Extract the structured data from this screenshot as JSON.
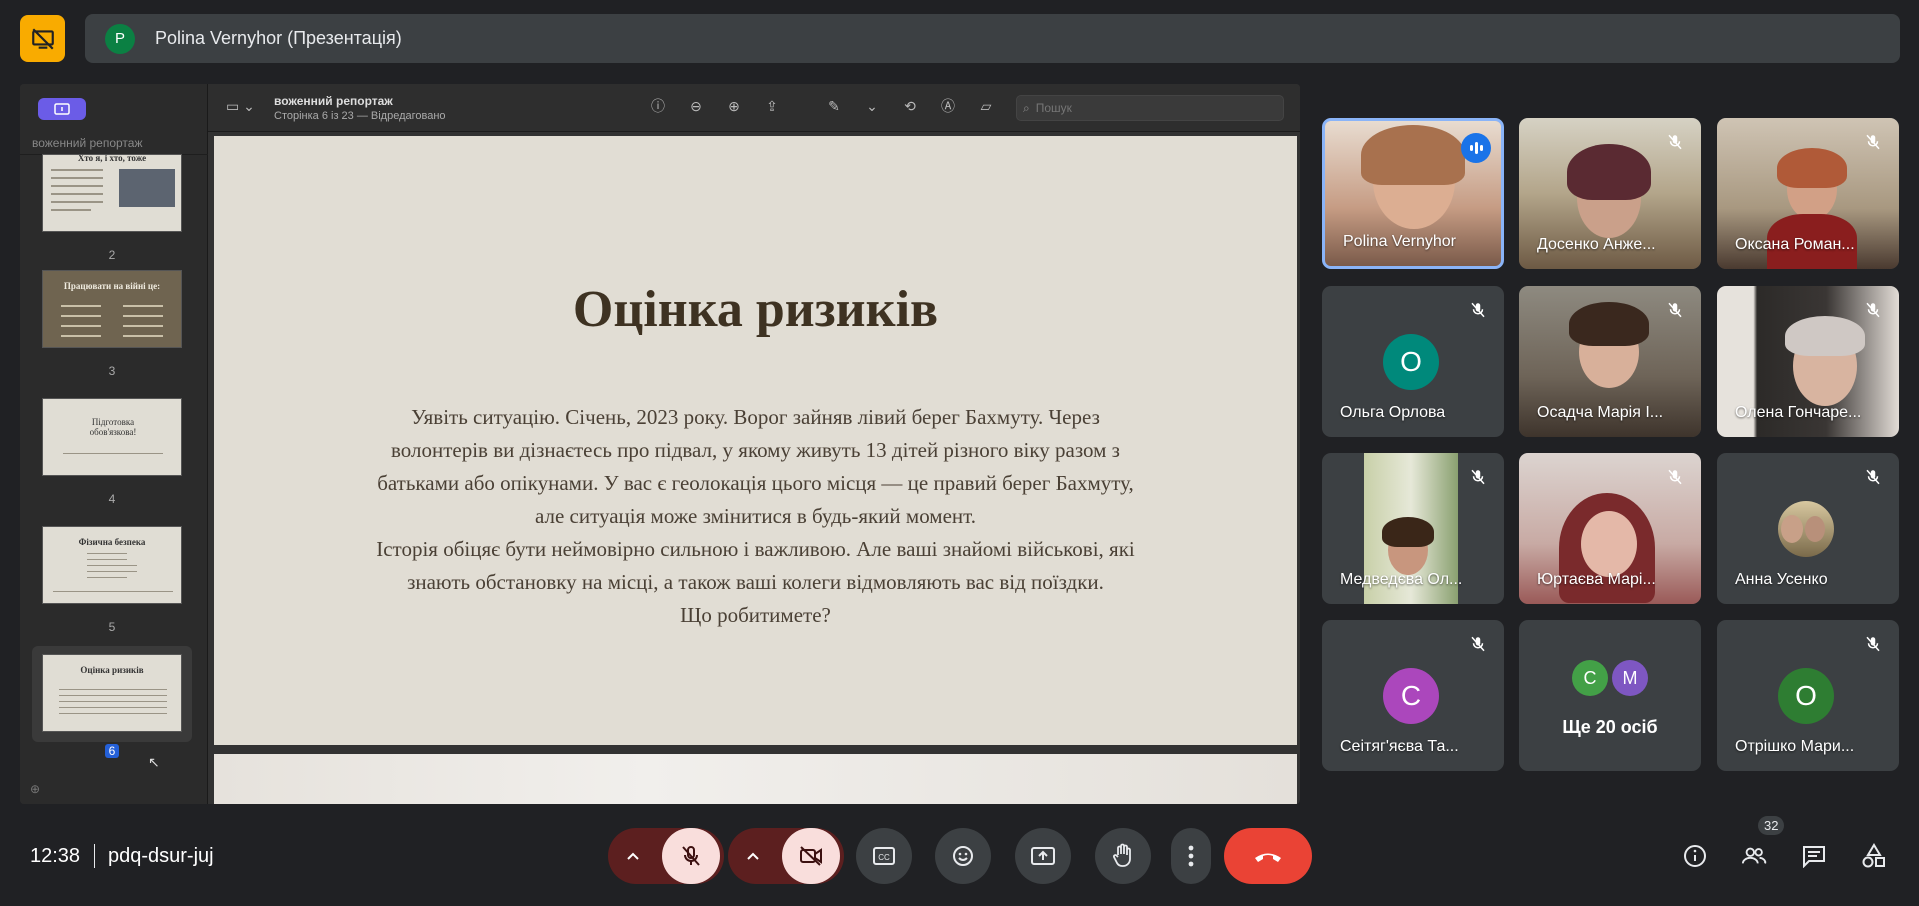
{
  "presenter_bar": {
    "avatar_letter": "P",
    "name": "Polina Vernyhor (Презентація)"
  },
  "viewer": {
    "sidebar_title": "воженний репортаж",
    "doc_title": "воженний репортаж",
    "doc_subtitle": "Сторінка 6 із 23 — Відредаговано",
    "search_placeholder": "Пошук",
    "thumbnails": [
      {
        "num": "2",
        "title": "Хто я, і хто, тоже"
      },
      {
        "num": "3",
        "title": "Працювати на війні це:"
      },
      {
        "num": "4",
        "title": "Підготовка обов'язкова!"
      },
      {
        "num": "5",
        "title": "Фізична безпека"
      },
      {
        "num": "6",
        "title": "Оцінка ризиків"
      }
    ]
  },
  "slide": {
    "title": "Оцінка ризиків",
    "lines": [
      "Уявіть ситуацію. Січень, 2023 року. Ворог зайняв лівий берег Бахмуту. Через",
      "волонтерів ви дізнаєтесь про підвал, у якому живуть 13 дітей різного віку разом з",
      "батьками або опікунами. У вас є геолокація цього місця — це правий берег Бахмуту,",
      "але ситуація може змінитися в будь-який момент.",
      "Історія обіцяє бути неймовірно сильною і важливою. Але ваші знайомі військові, які",
      "знають обстановку на місці, а також ваші колеги відмовляють вас від поїздки.",
      "Що робитимете?"
    ]
  },
  "participants": [
    {
      "name": "Polina Vernyhor",
      "type": "video",
      "speaking": true
    },
    {
      "name": "Досенко Анже...",
      "type": "video",
      "muted": true
    },
    {
      "name": "Оксана Роман...",
      "type": "video",
      "muted": true
    },
    {
      "name": "Ольга Орлова",
      "type": "avatar",
      "letter": "О",
      "color": "#00897b",
      "muted": true
    },
    {
      "name": "Осадча Марія І...",
      "type": "video",
      "muted": true
    },
    {
      "name": "Олена Гончаре...",
      "type": "video",
      "muted": true
    },
    {
      "name": "Медведєва Ол...",
      "type": "video",
      "muted": true
    },
    {
      "name": "Юртаєва Марі...",
      "type": "video",
      "muted": true
    },
    {
      "name": "Анна Усенко",
      "type": "photo-avatar",
      "muted": true
    },
    {
      "name": "Сеітяг'яєва Та...",
      "type": "avatar",
      "letter": "С",
      "color": "#ab47bc",
      "muted": true
    },
    {
      "name": "Ще 20 осіб",
      "type": "more",
      "letters": [
        "С",
        "М"
      ],
      "colors": [
        "#43a047",
        "#7e57c2"
      ]
    },
    {
      "name": "Отрішко Мари...",
      "type": "avatar",
      "letter": "О",
      "color": "#2e7d32",
      "muted": true
    }
  ],
  "bottom": {
    "time": "12:38",
    "meeting_code": "pdq-dsur-juj",
    "people_count": "32"
  }
}
